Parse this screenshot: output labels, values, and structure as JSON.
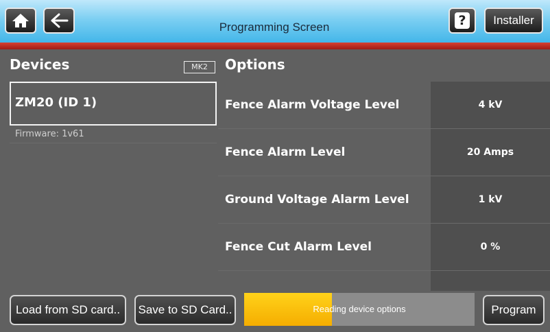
{
  "header": {
    "title": "Programming Screen",
    "home_icon": "home-icon",
    "back_icon": "arrow-left-icon",
    "help_label": "?",
    "installer_label": "Installer"
  },
  "devices": {
    "title": "Devices",
    "badge": "MK2",
    "items": [
      {
        "name": "ZM20 (ID 1)",
        "firmware": "Firmware: 1v61"
      }
    ]
  },
  "options": {
    "title": "Options",
    "rows": [
      {
        "label": "Fence Alarm Voltage Level",
        "value": "4 kV"
      },
      {
        "label": "Fence Alarm Level",
        "value": "20 Amps"
      },
      {
        "label": "Ground Voltage Alarm Level",
        "value": "1 kV"
      },
      {
        "label": "Fence Cut Alarm Level",
        "value": "0 %"
      },
      {
        "label": "",
        "value": ""
      }
    ]
  },
  "footer": {
    "load_label": "Load from SD card..",
    "save_label": "Save to SD Card..",
    "program_label": "Program",
    "progress_text": "Reading device options",
    "progress_fraction": 0.38
  },
  "colors": {
    "header_blue": "#43b6e9",
    "accent_red": "#c0281c",
    "progress_yellow": "#ffc800",
    "background": "#606060"
  }
}
